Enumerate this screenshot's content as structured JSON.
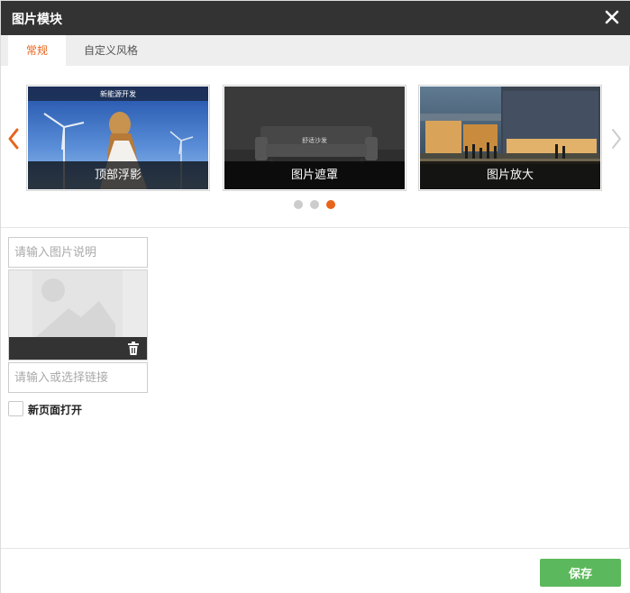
{
  "dialog": {
    "title": "图片模块",
    "close_icon": "close-icon"
  },
  "tabs": [
    {
      "label": "常规",
      "active": true
    },
    {
      "label": "自定义风格",
      "active": false
    }
  ],
  "carousel": {
    "cards": [
      {
        "caption": "顶部浮影",
        "overlay_text": "新能源开发",
        "icon": "wind-turbine-photo"
      },
      {
        "caption": "图片遮罩",
        "overlay_text": "舒适沙发",
        "icon": "sofa-photo"
      },
      {
        "caption": "图片放大",
        "overlay_text": "",
        "icon": "building-night-photo"
      }
    ],
    "page_count": 3,
    "active_page": 3,
    "prev_icon": "chevron-left-icon",
    "next_icon": "chevron-right-icon"
  },
  "form": {
    "caption_placeholder": "请输入图片说明",
    "caption_value": "",
    "link_placeholder": "请输入或选择链接",
    "link_value": "",
    "image_placeholder_icon": "image-placeholder-icon",
    "delete_icon": "trash-icon",
    "new_page_label": "新页面打开",
    "new_page_checked": false
  },
  "footer": {
    "save_label": "保存"
  },
  "colors": {
    "accent": "#e8641b",
    "titlebar": "#333333",
    "save": "#5cb85c"
  }
}
